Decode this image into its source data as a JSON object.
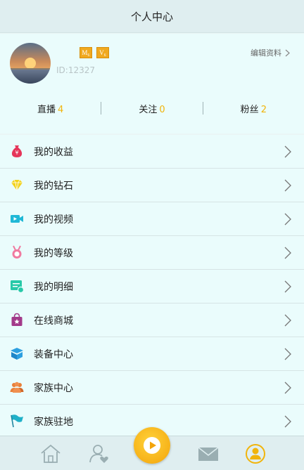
{
  "header": {
    "title": "个人中心"
  },
  "profile": {
    "badges": [
      "M₆",
      "V₆"
    ],
    "uid": "ID:12327",
    "edit_label": "编辑资料"
  },
  "stats": [
    {
      "label": "直播",
      "value": "4"
    },
    {
      "label": "关注",
      "value": "0"
    },
    {
      "label": "粉丝",
      "value": "2"
    }
  ],
  "menu": [
    {
      "label": "我的收益",
      "icon": "money-bag-icon"
    },
    {
      "label": "我的钻石",
      "icon": "diamond-icon"
    },
    {
      "label": "我的视频",
      "icon": "video-camera-icon"
    },
    {
      "label": "我的等级",
      "icon": "medal-icon"
    },
    {
      "label": "我的明细",
      "icon": "bill-icon"
    },
    {
      "label": "在线商城",
      "icon": "shopping-bag-icon"
    },
    {
      "label": "装备中心",
      "icon": "box-icon"
    },
    {
      "label": "家族中心",
      "icon": "people-icon"
    },
    {
      "label": "家族驻地",
      "icon": "flag-icon"
    }
  ],
  "colors": {
    "accent": "#f1b40b",
    "background": "#eafcfc"
  }
}
